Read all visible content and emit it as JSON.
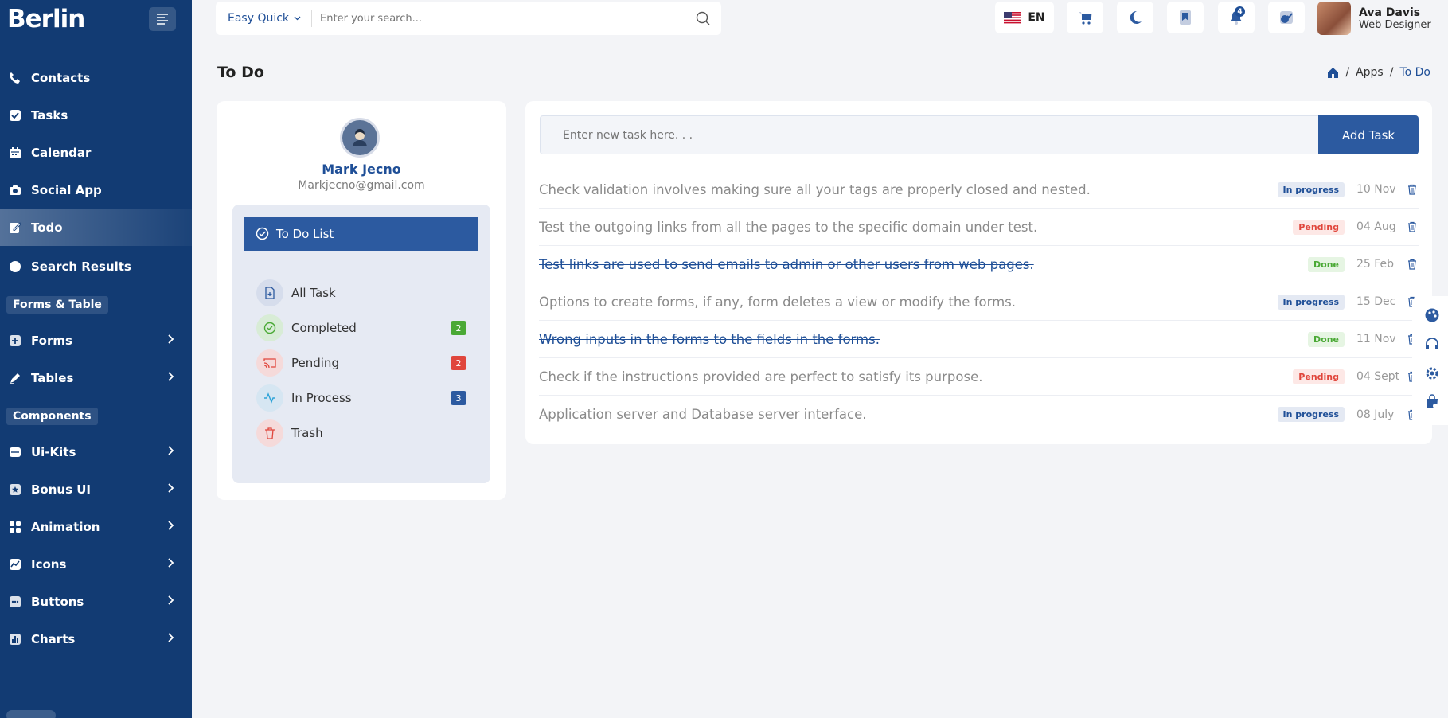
{
  "app": {
    "brand": "Berlin"
  },
  "sidebar": {
    "top_items": [
      {
        "label": "Contacts",
        "icon": "phone-icon"
      },
      {
        "label": "Tasks",
        "icon": "check-square-icon"
      },
      {
        "label": "Calendar",
        "icon": "calendar-icon"
      },
      {
        "label": "Social App",
        "icon": "camera-icon"
      },
      {
        "label": "Todo",
        "icon": "edit-icon",
        "active": true
      },
      {
        "label": "Search Results",
        "icon": "search-icon"
      }
    ],
    "section_forms": "Forms & Table",
    "forms_items": [
      {
        "label": "Forms",
        "icon": "plus-box-icon"
      },
      {
        "label": "Tables",
        "icon": "pen-icon"
      }
    ],
    "section_components": "Components",
    "component_items": [
      {
        "label": "Ui-Kits",
        "icon": "window-icon"
      },
      {
        "label": "Bonus UI",
        "icon": "star-box-icon"
      },
      {
        "label": "Animation",
        "icon": "grid-icon"
      },
      {
        "label": "Icons",
        "icon": "chart-line-icon"
      },
      {
        "label": "Buttons",
        "icon": "dots-box-icon"
      },
      {
        "label": "Charts",
        "icon": "bar-chart-icon"
      }
    ]
  },
  "topbar": {
    "search_quick": "Easy Quick",
    "search_placeholder": "Enter your search...",
    "language": "EN",
    "notification_count": "4",
    "user_name": "Ava Davis",
    "user_role": "Web Designer"
  },
  "page": {
    "title": "To Do",
    "breadcrumb": [
      "Apps",
      "To Do"
    ]
  },
  "profile": {
    "name": "Mark Jecno",
    "email": "Markjecno@gmail.com"
  },
  "todo_list": {
    "heading": "To Do List",
    "categories": [
      {
        "label": "All Task",
        "icon": "file-plus-icon"
      },
      {
        "label": "Completed",
        "icon": "check-circle-icon",
        "count": "2",
        "color": "#4aa935"
      },
      {
        "label": "Pending",
        "icon": "cast-icon",
        "count": "2",
        "color": "#e0463c"
      },
      {
        "label": "In Process",
        "icon": "activity-icon",
        "count": "3",
        "color": "#2c5aa0"
      },
      {
        "label": "Trash",
        "icon": "trash-icon"
      }
    ]
  },
  "new_task": {
    "placeholder": "Enter new task here. . .",
    "button": "Add Task"
  },
  "tasks": [
    {
      "text": "Check validation involves making sure all your tags are properly closed and nested.",
      "status": "In progress",
      "kind": "prog",
      "date": "10 Nov",
      "done": false
    },
    {
      "text": "Test the outgoing links from all the pages to the specific domain under test.",
      "status": "Pending",
      "kind": "pend",
      "date": "04 Aug",
      "done": false
    },
    {
      "text": "Test links are used to send emails to admin or other users from web pages.",
      "status": "Done",
      "kind": "done",
      "date": "25 Feb",
      "done": true
    },
    {
      "text": "Options to create forms, if any, form deletes a view or modify the forms.",
      "status": "In progress",
      "kind": "prog",
      "date": "15 Dec",
      "done": false
    },
    {
      "text": "Wrong inputs in the forms to the fields in the forms.",
      "status": "Done",
      "kind": "done",
      "date": "11 Nov",
      "done": true
    },
    {
      "text": "Check if the instructions provided are perfect to satisfy its purpose.",
      "status": "Pending",
      "kind": "pend",
      "date": "04 Sept",
      "done": false
    },
    {
      "text": "Application server and Database server interface.",
      "status": "In progress",
      "kind": "prog",
      "date": "08 July",
      "done": false
    }
  ],
  "colors": {
    "sidebar": "#123b73",
    "primary": "#2c5aa0",
    "pending": "#e0463c",
    "done": "#4aa935"
  }
}
